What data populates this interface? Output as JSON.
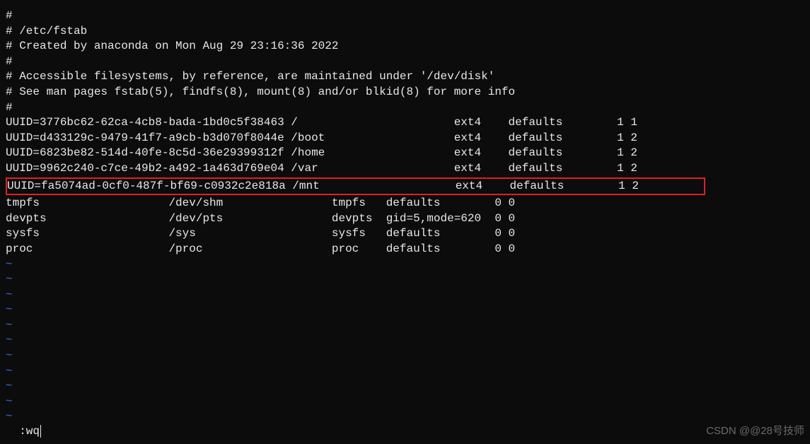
{
  "comments": {
    "l0": "#",
    "l1": "# /etc/fstab",
    "l2": "# Created by anaconda on Mon Aug 29 23:16:36 2022",
    "l3": "#",
    "l4": "# Accessible filesystems, by reference, are maintained under '/dev/disk'",
    "l5": "# See man pages fstab(5), findfs(8), mount(8) and/or blkid(8) for more info",
    "l6": "#"
  },
  "entries": {
    "e0": "UUID=3776bc62-62ca-4cb8-bada-1bd0c5f38463 /                       ext4    defaults        1 1",
    "e1": "UUID=d433129c-9479-41f7-a9cb-b3d070f8044e /boot                   ext4    defaults        1 2",
    "e2": "UUID=6823be82-514d-40fe-8c5d-36e29399312f /home                   ext4    defaults        1 2",
    "e3": "UUID=9962c240-c7ce-49b2-a492-1a463d769e04 /var                    ext4    defaults        1 2",
    "e4": "UUID=fa5074ad-0cf0-487f-bf69-c0932c2e818a /mnt                    ext4    defaults        1 2",
    "e5": "tmpfs                   /dev/shm                tmpfs   defaults        0 0",
    "e6": "devpts                  /dev/pts                devpts  gid=5,mode=620  0 0",
    "e7": "sysfs                   /sys                    sysfs   defaults        0 0",
    "e8": "proc                    /proc                   proc    defaults        0 0"
  },
  "tilde_glyph": "~",
  "command": ":wq",
  "watermark": "CSDN @@28号技师"
}
